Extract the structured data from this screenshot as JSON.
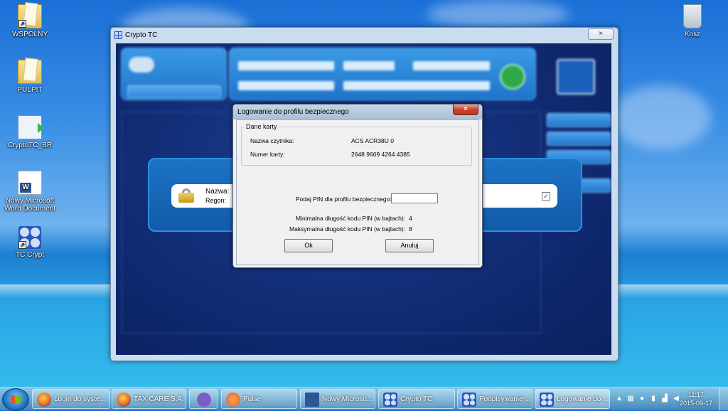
{
  "desktop": {
    "icons": [
      {
        "label": "WSPOLNY"
      },
      {
        "label": "PULPIT"
      },
      {
        "label": "CryptoTC_BR"
      },
      {
        "label": "Nowy Microsoft Word Document"
      },
      {
        "label": "TC Crypt"
      },
      {
        "label": "Kosz"
      }
    ]
  },
  "app_window": {
    "title": "Crypto TC",
    "close_glyph": "×",
    "card": {
      "name_label": "Nazwa:",
      "region_label": "Regon:",
      "check_glyph": "✓"
    }
  },
  "dialog": {
    "title": "Logowanie do profilu bezpiecznego",
    "close_glyph": "×",
    "card_group_legend": "Dane karty",
    "reader_label": "Nazwa czytnika:",
    "reader_value": "ACS ACR38U 0",
    "card_number_label": "Numer karty:",
    "card_number_value": "2648 9669 4264 4385",
    "pin_prompt": "Podaj PIN dla profilu bezpiecznego:",
    "pin_value": "",
    "min_label": "Minimalna długość kodu PIN (w bajtach):",
    "min_value": "4",
    "max_label": "Maksymalna długość kodu PIN (w bajtach):",
    "max_value": "8",
    "ok_label": "Ok",
    "cancel_label": "Anuluj"
  },
  "taskbar": {
    "items": [
      {
        "label": "Login do syste...",
        "icon": "firefox-icon"
      },
      {
        "label": "TAX CARE S.A. ...",
        "icon": "firefox-icon"
      },
      {
        "label": "",
        "icon": "viber-icon"
      },
      {
        "label": "Pulse",
        "icon": "pulse-icon"
      },
      {
        "label": "Nowy Microso...",
        "icon": "word-icon"
      },
      {
        "label": "Crypto TC",
        "icon": "tc-crypt-icon"
      },
      {
        "label": "Podpisywanie ...",
        "icon": "tc-crypt-icon"
      },
      {
        "label": "Logowanie do ...",
        "icon": "tc-crypt-icon"
      }
    ],
    "clock_time": "11:17",
    "clock_date": "2015-09-17"
  }
}
